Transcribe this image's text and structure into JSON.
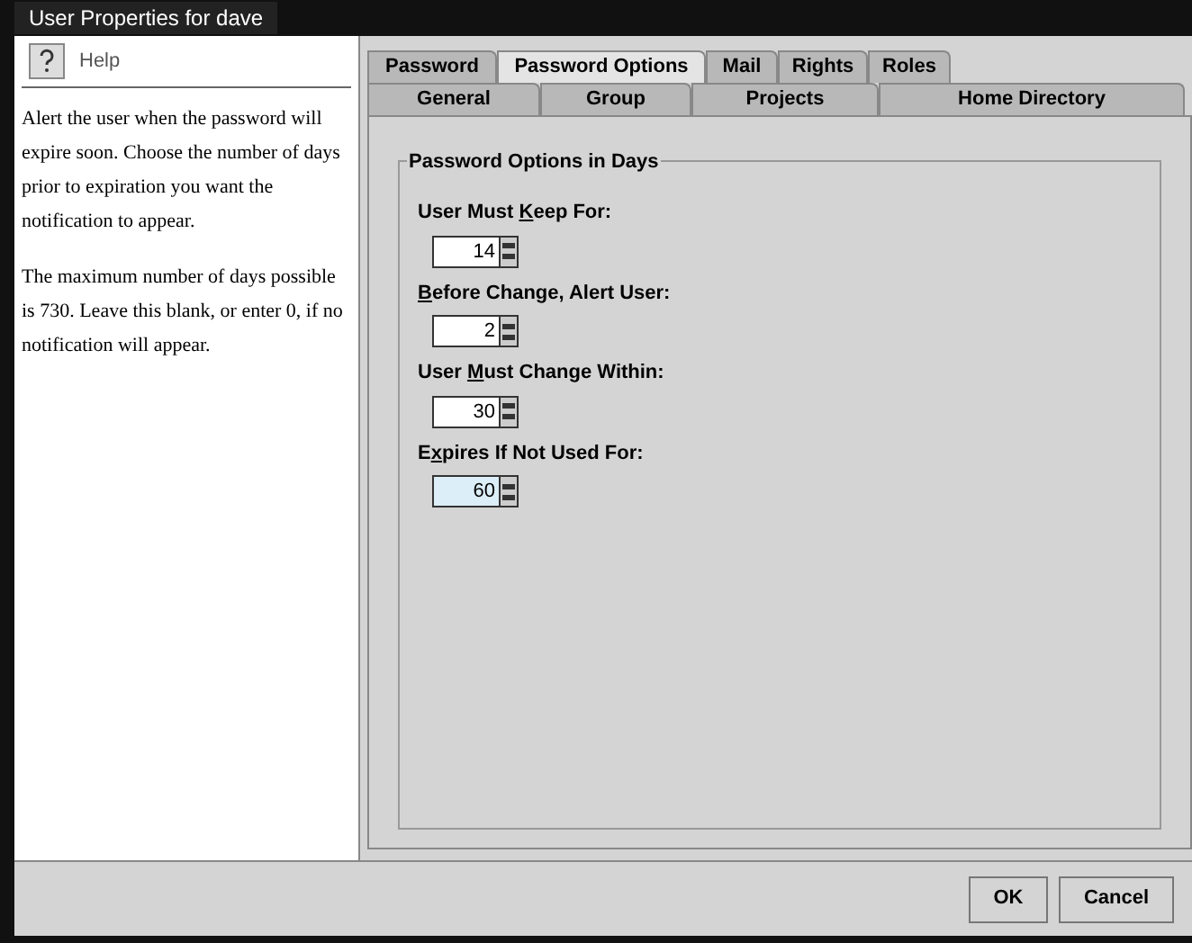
{
  "window": {
    "title": "User Properties for dave"
  },
  "help": {
    "title": "Help",
    "paragraphs": [
      "Alert the user when the password will expire soon. Choose the number of days prior to expiration you want the notification to appear.",
      "The maximum number of days possible is 730. Leave this blank, or enter 0, if no notification will appear."
    ]
  },
  "tab_rows": [
    [
      {
        "label": "Password",
        "selected": false
      },
      {
        "label": "Password Options",
        "selected": true
      },
      {
        "label": "Mail",
        "selected": false
      },
      {
        "label": "Rights",
        "selected": false
      },
      {
        "label": "Roles",
        "selected": false
      }
    ],
    [
      {
        "label": "General",
        "selected": false
      },
      {
        "label": "Group",
        "selected": false
      },
      {
        "label": "Projects",
        "selected": false
      },
      {
        "label": "Home Directory",
        "selected": false
      }
    ]
  ],
  "group": {
    "title": "Password Options in Days",
    "fields": [
      {
        "label_before": "User Must ",
        "mnemonic": "K",
        "label_after": "eep For:",
        "value": "14",
        "focused": false
      },
      {
        "mnemonic": "B",
        "label_after": "efore Change, Alert User:",
        "value": "2",
        "focused": false
      },
      {
        "label_before": "User ",
        "mnemonic": "M",
        "label_after": "ust Change Within:",
        "value": "30",
        "focused": false
      },
      {
        "label_before": "E",
        "mnemonic": "x",
        "label_after": "pires If Not Used For:",
        "value": "60",
        "focused": true
      }
    ]
  },
  "buttons": [
    "OK",
    "Cancel"
  ]
}
